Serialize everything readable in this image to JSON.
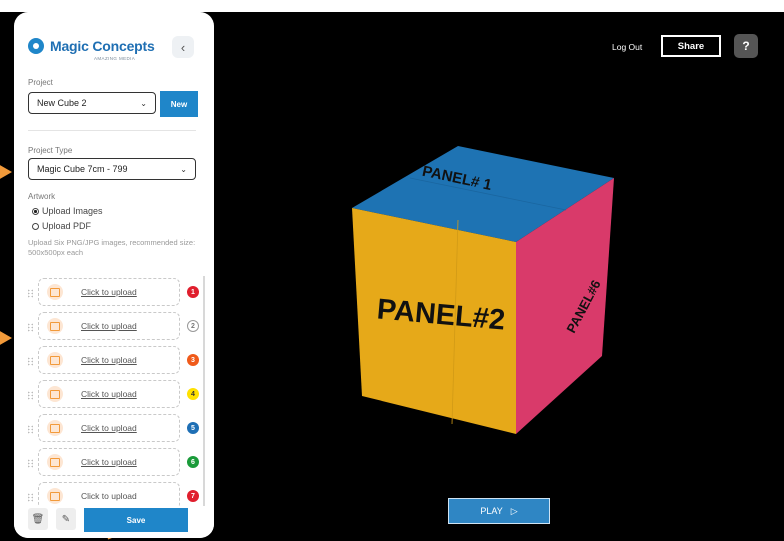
{
  "brand": {
    "name": "Magic Concepts",
    "tagline": "AMAZING MEDIA"
  },
  "nav": {
    "collapse_glyph": "‹"
  },
  "project": {
    "label": "Project",
    "selected": "New Cube 2",
    "new_button": "New"
  },
  "project_type": {
    "label": "Project Type",
    "selected": "Magic Cube 7cm - 799"
  },
  "artwork": {
    "label": "Artwork",
    "options": [
      {
        "label": "Upload Images",
        "selected": true
      },
      {
        "label": "Upload PDF",
        "selected": false
      }
    ],
    "hint": "Upload Six PNG/JPG images, recommended size: 500x500px each"
  },
  "uploads": [
    {
      "text": "Click to upload",
      "number": "1",
      "color": "#e01e2d"
    },
    {
      "text": "Click to upload",
      "number": "2",
      "color": "#ffffff"
    },
    {
      "text": "Click to upload",
      "number": "3",
      "color": "#f05a1a"
    },
    {
      "text": "Click to upload",
      "number": "4",
      "color": "#ffe100"
    },
    {
      "text": "Click to upload",
      "number": "5",
      "color": "#1e6fb5"
    },
    {
      "text": "Click to upload",
      "number": "6",
      "color": "#1a9b3a"
    },
    {
      "text": "Click to upload",
      "number": "7",
      "color": "#e01e2d"
    }
  ],
  "footer": {
    "save_label": "Save",
    "delete_icon": "trash-icon",
    "edit_icon": "edit-icon"
  },
  "header": {
    "logout_label": "Log Out",
    "share_label": "Share",
    "help_label": "?"
  },
  "preview": {
    "play_label": "PLAY",
    "play_glyph": "▷",
    "panels": {
      "top": "PANEL# 1",
      "front": "PANEL#2",
      "right": "PANEL#6"
    },
    "colors": {
      "top": "#1e73b3",
      "front": "#e6a919",
      "right": "#d93a6a"
    }
  }
}
